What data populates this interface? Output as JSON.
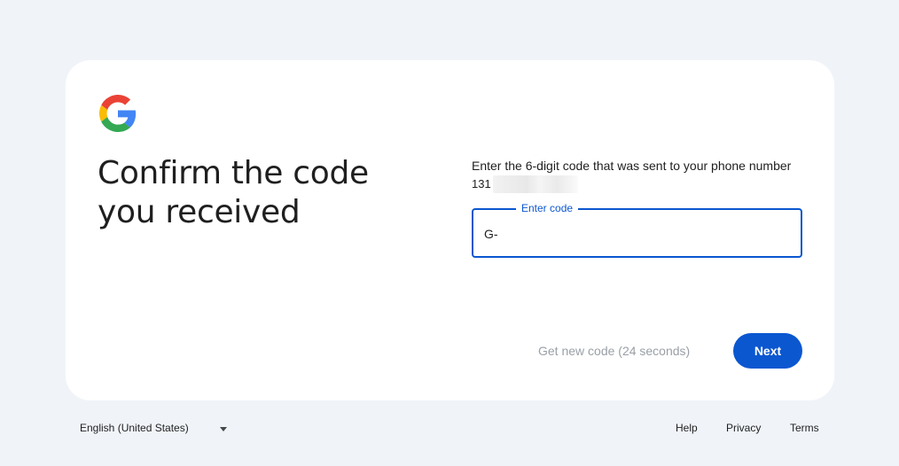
{
  "card": {
    "title": "Confirm the code you received",
    "instructions": "Enter the 6-digit code that was sent to your phone number",
    "phone_prefix": "131"
  },
  "code_field": {
    "label": "Enter code",
    "value": "G-"
  },
  "actions": {
    "resend_label": "Get new code (24 seconds)",
    "next_label": "Next"
  },
  "footer": {
    "language": "English (United States)",
    "links": [
      "Help",
      "Privacy",
      "Terms"
    ]
  },
  "colors": {
    "accent": "#0b57d0",
    "background": "#f0f4f9",
    "card": "#ffffff"
  }
}
